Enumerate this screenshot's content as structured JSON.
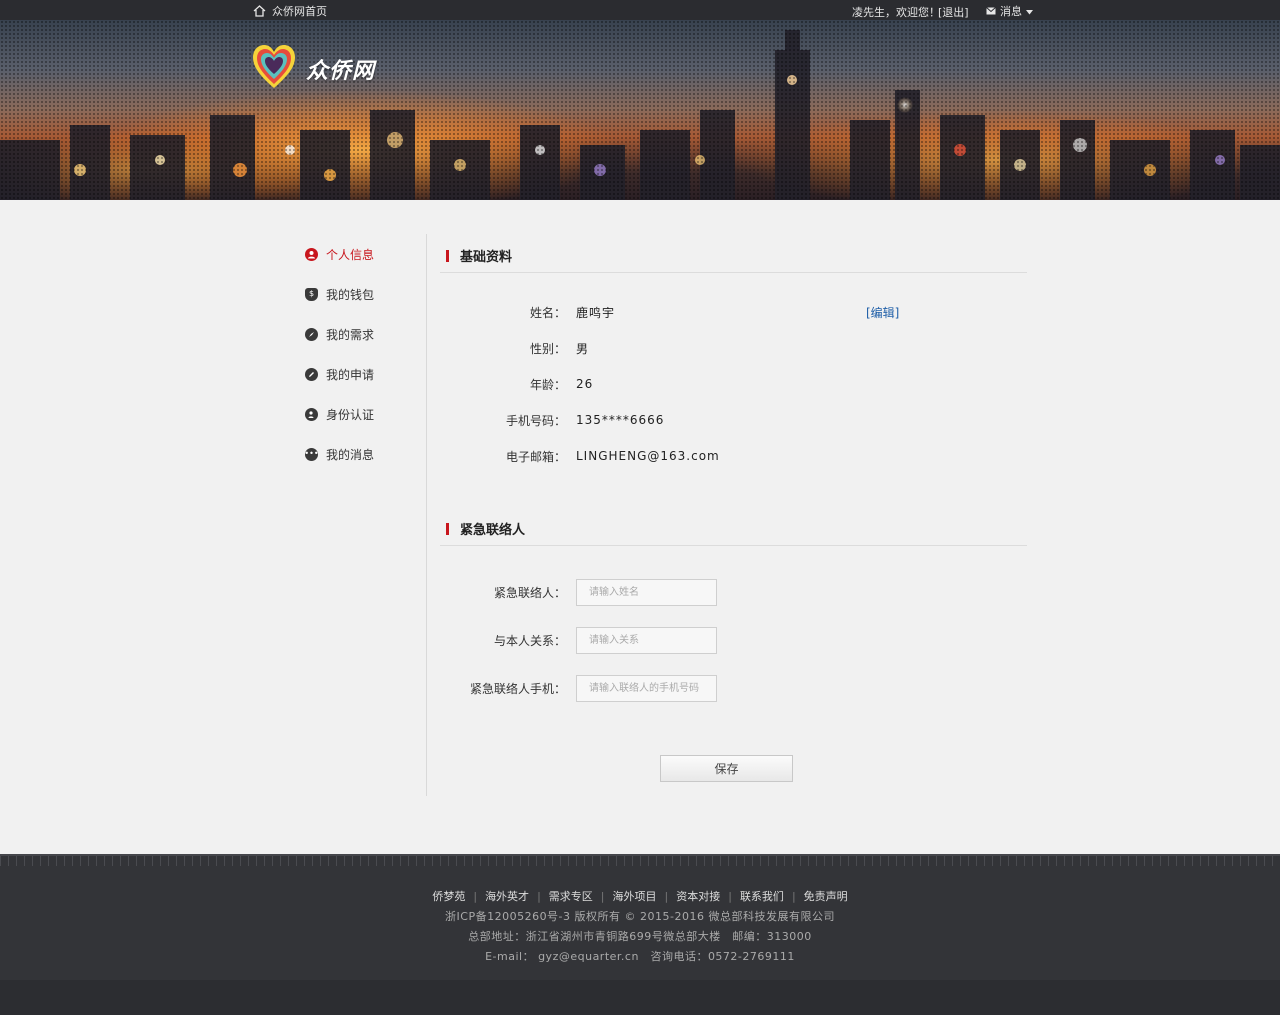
{
  "topbar": {
    "home_label": "众侨网首页",
    "welcome": "凌先生，欢迎您！",
    "logout": "[退出]",
    "messages": "消息"
  },
  "brand": {
    "name": "众侨网"
  },
  "sidebar": {
    "items": [
      {
        "label": "个人信息",
        "icon": "user-icon",
        "active": true
      },
      {
        "label": "我的钱包",
        "icon": "money-bag-icon",
        "active": false
      },
      {
        "label": "我的需求",
        "icon": "compass-icon",
        "active": false
      },
      {
        "label": "我的申请",
        "icon": "pencil-icon",
        "active": false
      },
      {
        "label": "身份认证",
        "icon": "id-badge-icon",
        "active": false
      },
      {
        "label": "我的消息",
        "icon": "chat-icon",
        "active": false
      }
    ]
  },
  "basic": {
    "title": "基础资料",
    "edit": "[编辑]",
    "rows": [
      {
        "label": "姓名：",
        "value": "鹿鸣宇"
      },
      {
        "label": "性别：",
        "value": "男"
      },
      {
        "label": "年龄：",
        "value": "26"
      },
      {
        "label": "手机号码：",
        "value": "135****6666"
      },
      {
        "label": "电子邮箱：",
        "value": "LINGHENG@163.com"
      }
    ]
  },
  "emergency": {
    "title": "紧急联络人",
    "fields": [
      {
        "label": "紧急联络人：",
        "placeholder": "请输入姓名",
        "value": ""
      },
      {
        "label": "与本人关系：",
        "placeholder": "请输入关系",
        "value": ""
      },
      {
        "label": "紧急联络人手机：",
        "placeholder": "请输入联络人的手机号码",
        "value": ""
      }
    ],
    "save": "保存"
  },
  "footer": {
    "links": [
      "侨梦苑",
      "海外英才",
      "需求专区",
      "海外项目",
      "资本对接",
      "联系我们",
      "免责声明"
    ],
    "copyright": "浙ICP备12005260号-3 版权所有 © 2015-2016 微总部科技发展有限公司",
    "address": "总部地址：浙江省湖州市青铜路699号微总部大楼　邮编：313000",
    "contact": "E-mail： gyz@equarter.cn　咨询电话：0572-2769111"
  },
  "colors": {
    "accent": "#c8161d",
    "link": "#1f5fa8",
    "topbar": "#2b2c30",
    "footer": "#333438"
  }
}
